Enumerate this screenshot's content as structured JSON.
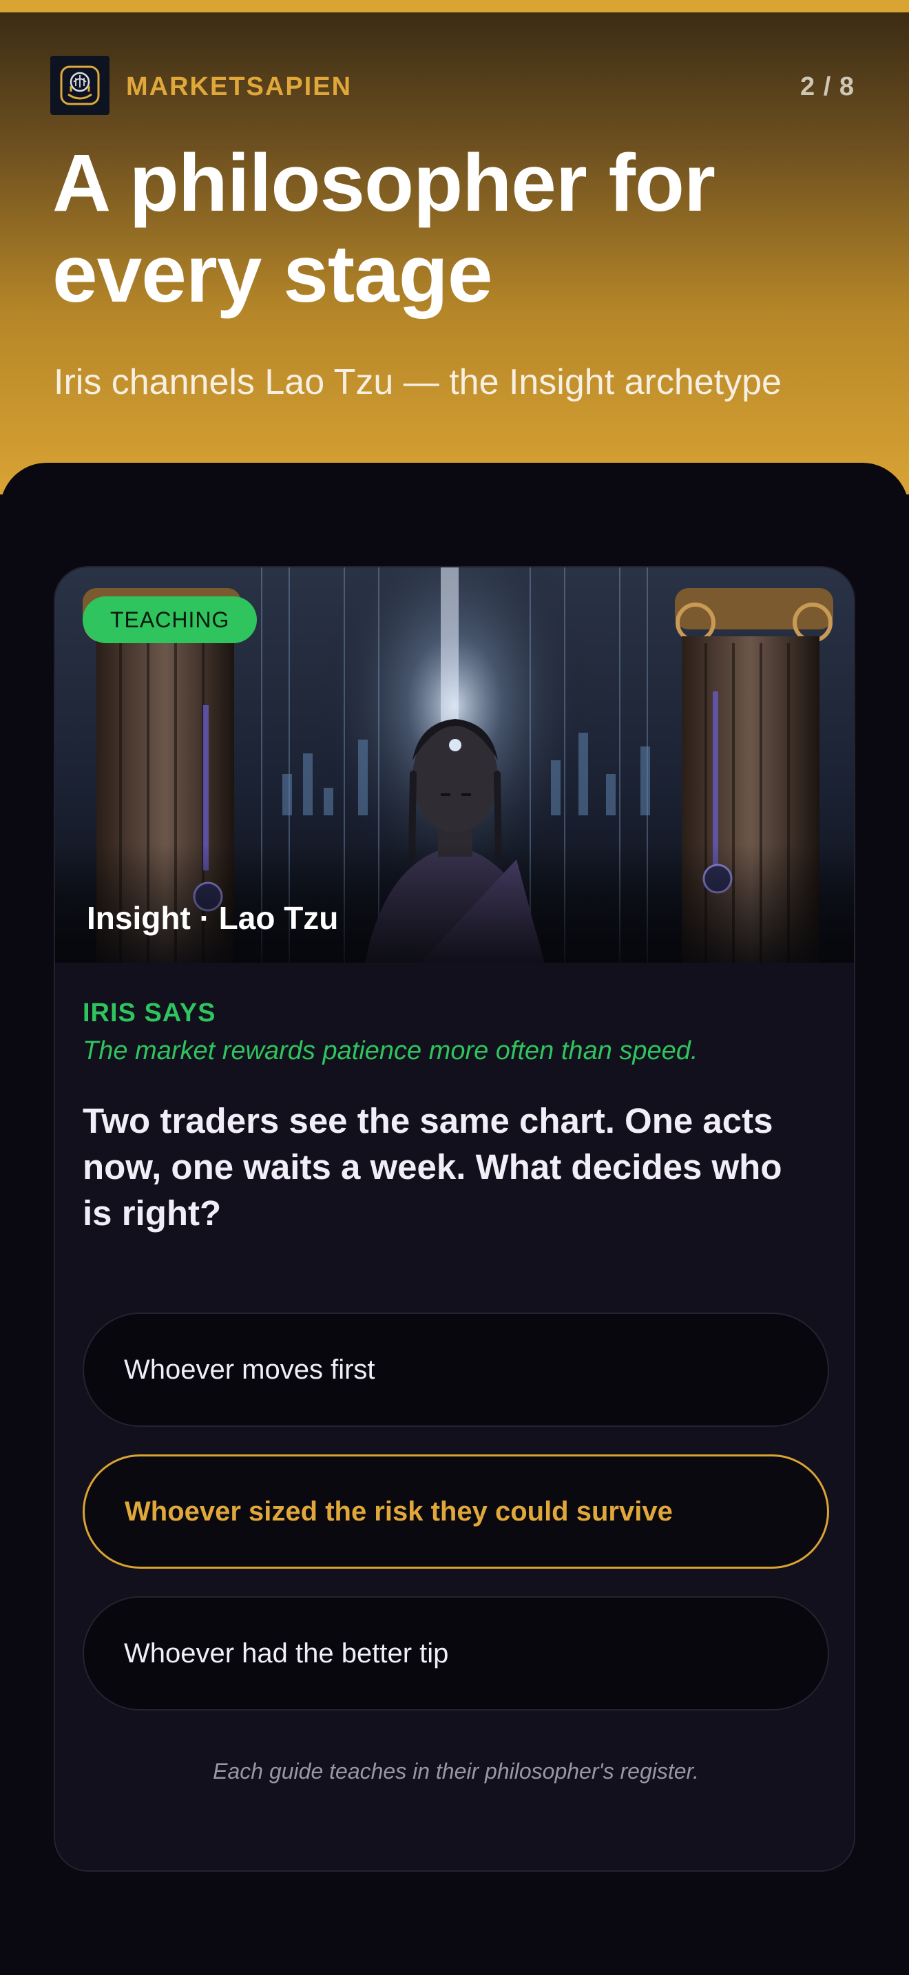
{
  "header": {
    "brand": "MARKETSAPIEN",
    "progress": "2 / 8",
    "title": "A philosopher for every stage",
    "subtitle": "Iris channels Lao Tzu — the Insight archetype",
    "accent_color": "#d9a432",
    "logo_icon": "brain-hand-icon"
  },
  "card": {
    "badge": "TEACHING",
    "badge_color": "#2fc45e",
    "image_caption": "Insight · Lao Tzu",
    "speaker_label": "IRIS SAYS",
    "speaker_quote": "The market rewards patience more often than speed.",
    "question": "Two traders see the same chart. One acts now, one waits a week. What decides who is right?",
    "options": [
      {
        "label": "Whoever moves first",
        "selected": false
      },
      {
        "label": "Whoever sized the risk they could survive",
        "selected": true
      },
      {
        "label": "Whoever had the better tip",
        "selected": false
      }
    ],
    "footer_note": "Each guide teaches in their philosopher's register."
  }
}
